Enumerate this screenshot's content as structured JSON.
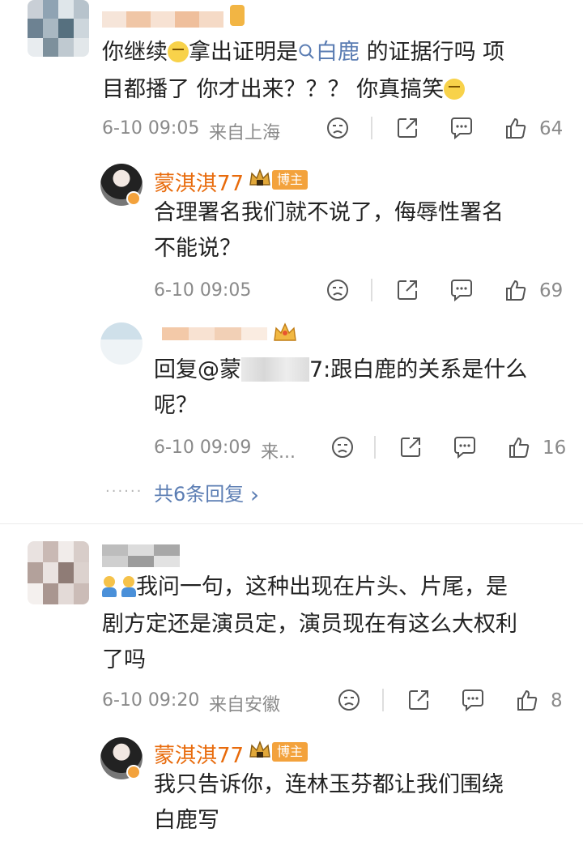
{
  "thread1": {
    "comment": {
      "line1_a": "你继续",
      "line1_b": "拿出证明是",
      "topic": "白鹿",
      "line1_c": " 的证据行吗 项",
      "line2_a": "目都播了 你才出来？？？ 你真搞笑",
      "time": "6-10 09:05",
      "source": "来自上海",
      "likes": "64"
    },
    "reply1": {
      "username": "蒙淇淇77",
      "tag": "博主",
      "line1": "合理署名我们就不说了，侮辱性署名",
      "line2": "不能说？",
      "time": "6-10 09:05",
      "likes": "69"
    },
    "reply2": {
      "line1_a": "回复@蒙",
      "line1_b": "7:跟白鹿的关系是什么",
      "line2": "呢？",
      "time": "6-10 09:09",
      "source": "来...",
      "likes": "16"
    },
    "more": {
      "dots": "······",
      "label": "共6条回复",
      "chevron": "›"
    }
  },
  "thread2": {
    "comment": {
      "line1": "我问一句，这种出现在片头、片尾，是",
      "line2": "剧方定还是演员定，演员现在有这么大权利",
      "line3": "了吗",
      "time": "6-10 09:20",
      "source": "来自安徽",
      "likes": "8"
    },
    "reply1": {
      "username": "蒙淇淇77",
      "tag": "博主",
      "line1": "我只告诉你，连林玉芬都让我们围绕",
      "line2": "白鹿写"
    }
  },
  "colors": {
    "username": "#e86b0c",
    "link": "#5b7db3",
    "meta": "#8a8a8a",
    "badge": "#f3a23c"
  },
  "icons": [
    "dislike-icon",
    "share-icon",
    "comment-icon",
    "like-icon",
    "search-icon",
    "crown-icon",
    "vip-badge-icon"
  ]
}
